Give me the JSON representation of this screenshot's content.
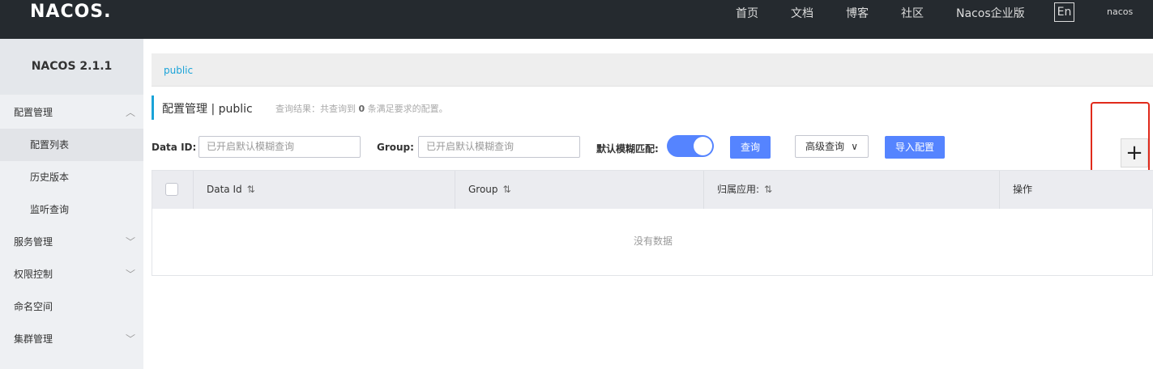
{
  "header": {
    "logo": "NACOS.",
    "nav": [
      "首页",
      "文档",
      "博客",
      "社区",
      "Nacos企业版"
    ],
    "lang": "En",
    "user": "nacos"
  },
  "sidebar": {
    "title": "NACOS 2.1.1",
    "items": [
      {
        "label": "配置管理"
      },
      {
        "label": "配置列表"
      },
      {
        "label": "历史版本"
      },
      {
        "label": "监听查询"
      },
      {
        "label": "服务管理"
      },
      {
        "label": "权限控制"
      },
      {
        "label": "命名空间"
      },
      {
        "label": "集群管理"
      }
    ]
  },
  "namespace": {
    "current": "public"
  },
  "page": {
    "title": "配置管理 | public",
    "result_prefix": "查询结果：共查询到 ",
    "result_count": "0",
    "result_suffix": " 条满足要求的配置。"
  },
  "filters": {
    "data_id_label": "Data ID:",
    "data_id_placeholder": "已开启默认模糊查询",
    "group_label": "Group:",
    "group_placeholder": "已开启默认模糊查询",
    "fuzzy_label": "默认模糊匹配:",
    "fuzzy_enabled": true,
    "query_button": "查询",
    "advanced_button": "高级查询",
    "import_button": "导入配置",
    "add_button": "+"
  },
  "table": {
    "columns": [
      "Data Id",
      "Group",
      "归属应用:",
      "操作"
    ],
    "empty_text": "没有数据"
  }
}
